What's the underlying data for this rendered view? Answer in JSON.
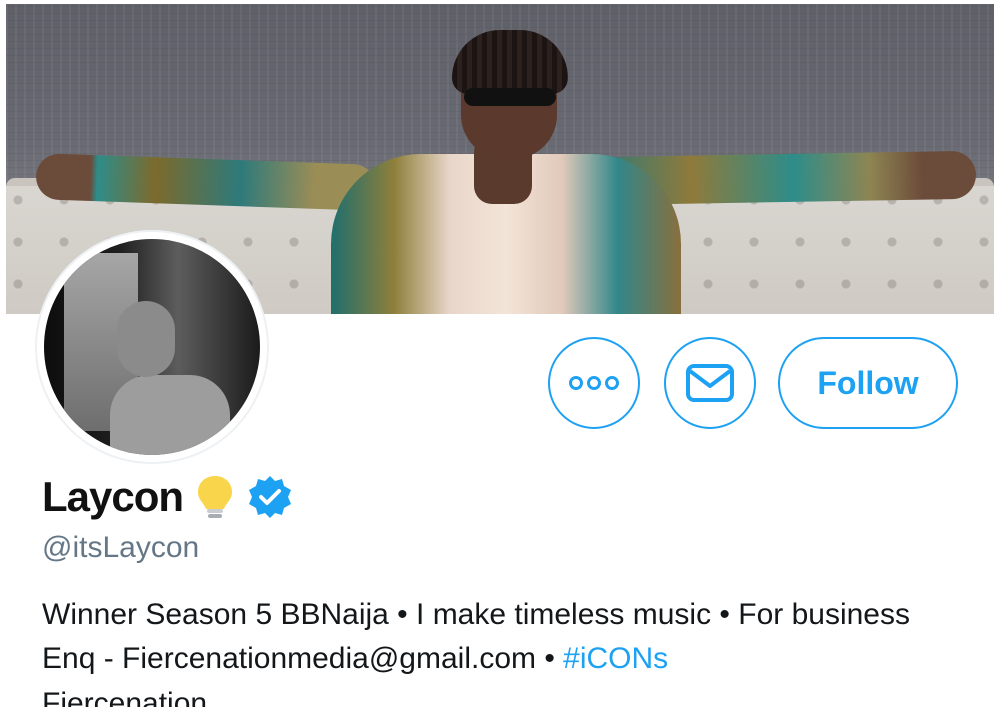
{
  "profile": {
    "display_name": "Laycon",
    "handle": "@itsLaycon",
    "bio": "Winner Season 5 BBNaija • I make timeless music • For business Enq - Fiercenationmedia@gmail.com • ",
    "hashtag": "#iCONs",
    "bio_cut": "Fiercenation"
  },
  "actions": {
    "follow_label": "Follow"
  },
  "icons": {
    "more": "more-icon",
    "message": "mail-icon",
    "verified": "verified-badge-icon",
    "lightbulb": "lightbulb-emoji-icon"
  },
  "colors": {
    "accent": "#1da1f2",
    "text": "#14171a",
    "secondary": "#657786"
  }
}
